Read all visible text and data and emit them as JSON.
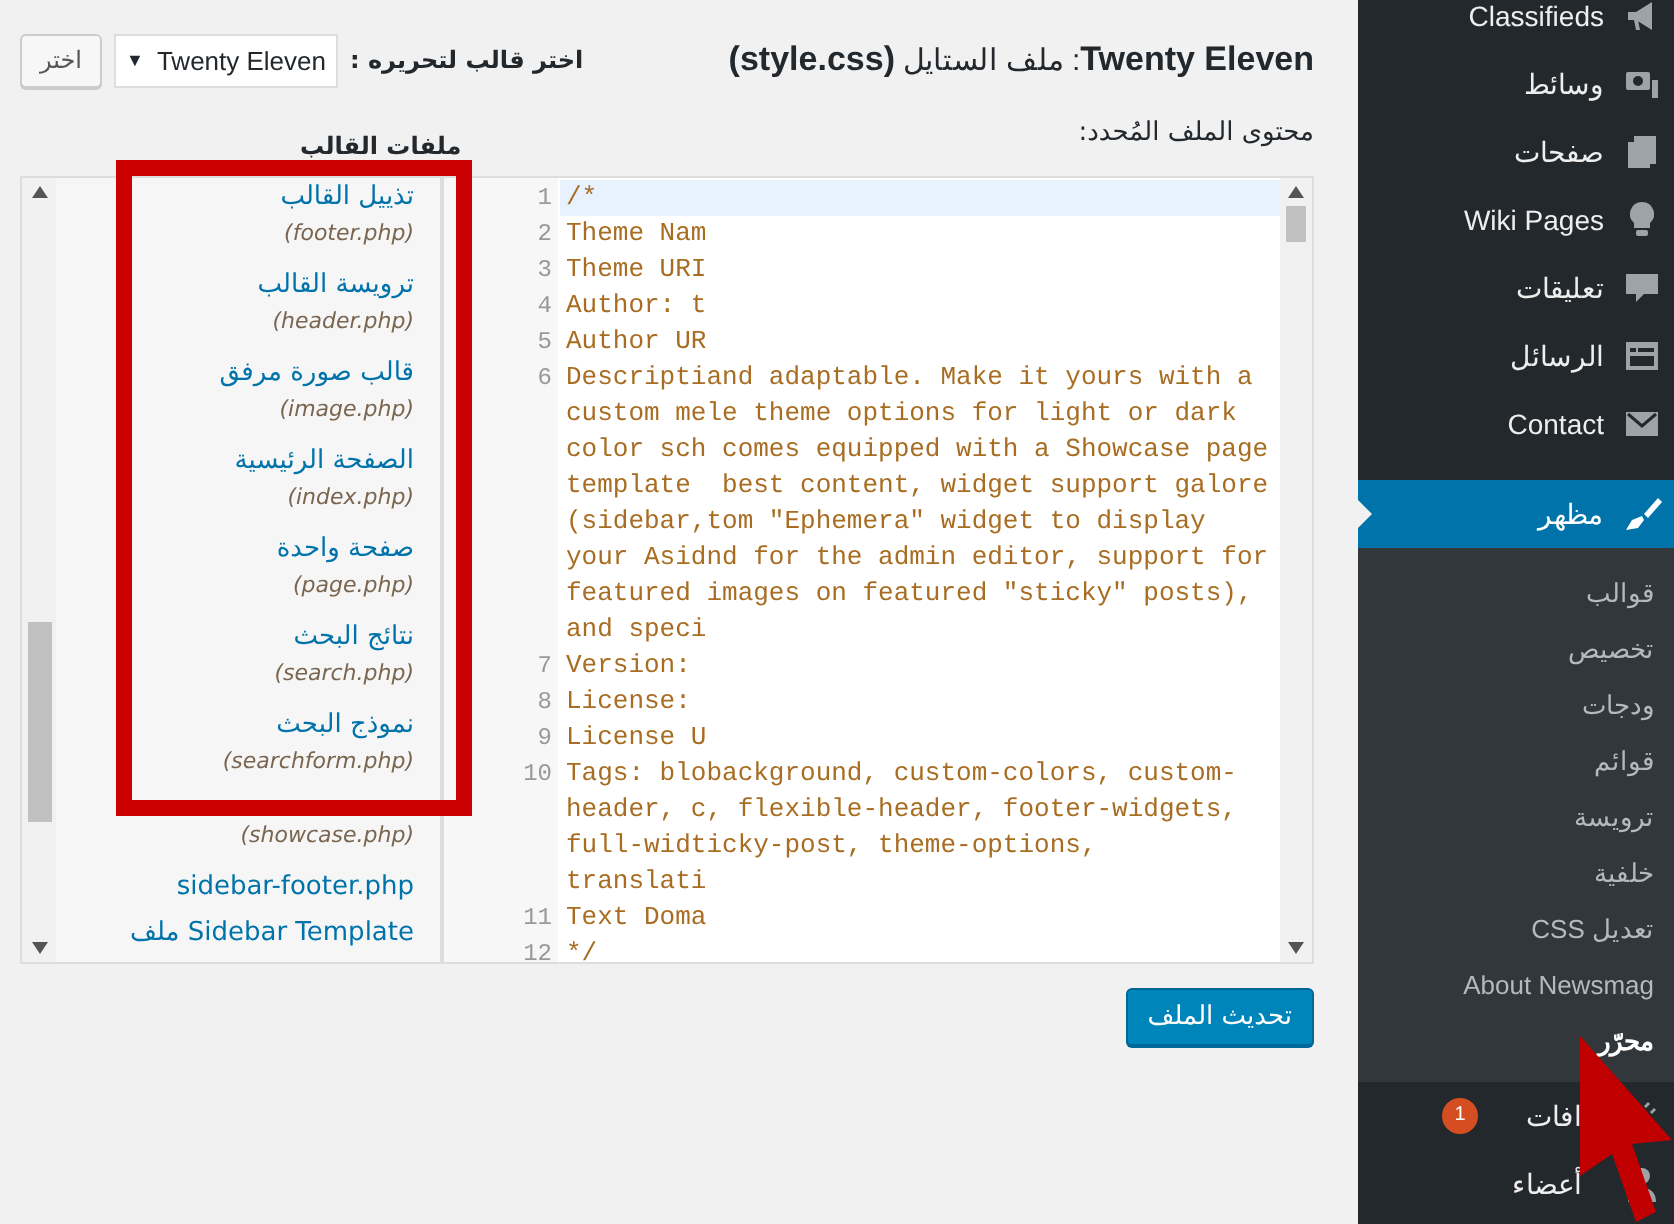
{
  "header": {
    "title": "**Twenty Eleven**: ملف الستايل **(style.css)**",
    "theme_label": "اختر قالب لتحريره :",
    "theme_select": "Twenty Eleven",
    "select_caret": "▼",
    "select_button": "اختر"
  },
  "editor_label": "محتوى الملف المُحدد:",
  "files_heading": "ملفات القالب",
  "files": [
    {
      "title": "تذييل القالب",
      "file": "(footer.php)"
    },
    {
      "title": "ترويسة القالب",
      "file": "(header.php)"
    },
    {
      "title": "قالب صورة مرفق",
      "file": "(image.php)"
    },
    {
      "title": "الصفحة الرئيسية",
      "file": "(index.php)"
    },
    {
      "title": "صفحة واحدة",
      "file": "(page.php)"
    },
    {
      "title": "نتائج البحث",
      "file": "(search.php)"
    },
    {
      "title": "نموذج البحث",
      "file": "(searchform.php)"
    },
    {
      "file": "(showcase.php)"
    },
    {
      "title": "sidebar-footer.php"
    },
    {
      "title": "Sidebar Template ملف"
    }
  ],
  "code_lines": [
    {
      "number": "1",
      "active": true,
      "rows": [
        "/*"
      ]
    },
    {
      "number": "2",
      "active": false,
      "rows": [
        "Theme Nam"
      ]
    },
    {
      "number": "3",
      "active": false,
      "rows": [
        "Theme URI"
      ]
    },
    {
      "number": "4",
      "active": false,
      "rows": [
        "Author: t"
      ]
    },
    {
      "number": "5",
      "active": false,
      "rows": [
        "Author UR"
      ]
    },
    {
      "number": "6",
      "active": false,
      "rows": [
        "Descriptiand adaptable. Make it yours with a",
        "custom mele theme options for light or dark",
        "color sch comes equipped with a Showcase page",
        "template  best content, widget support galore",
        "(sidebar,tom \"Ephemera\" widget to display",
        "your Asidnd for the admin editor, support for",
        "featured images on featured \"sticky\" posts),",
        "and speci"
      ]
    },
    {
      "number": "7",
      "active": false,
      "rows": [
        "Version:"
      ]
    },
    {
      "number": "8",
      "active": false,
      "rows": [
        "License:"
      ]
    },
    {
      "number": "9",
      "active": false,
      "rows": [
        "License U"
      ]
    },
    {
      "number": "10",
      "active": false,
      "rows": [
        "Tags: blobackground, custom-colors, custom-",
        "header, c, flexible-header, footer-widgets,",
        "full-widticky-post, theme-options,",
        "translati"
      ]
    },
    {
      "number": "11",
      "active": false,
      "rows": [
        "Text Doma"
      ]
    },
    {
      "number": "12",
      "active": false,
      "rows": [
        "*/"
      ]
    }
  ],
  "update_button": "تحديث الملف",
  "menu": [
    {
      "label": "Classifieds",
      "selected": false
    },
    {
      "label": "وسائط",
      "selected": false
    },
    {
      "label": "صفحات",
      "selected": false
    },
    {
      "label": "Wiki Pages",
      "selected": false
    },
    {
      "label": "تعليقات",
      "selected": false
    },
    {
      "label": "الرسائل",
      "selected": false
    },
    {
      "label": "Contact",
      "selected": false
    },
    {
      "label": "مظهر",
      "selected": true,
      "children": [
        {
          "label": "قوالب",
          "selected": false
        },
        {
          "label": "تخصيص",
          "selected": false
        },
        {
          "label": "ودجات",
          "selected": false
        },
        {
          "label": "قوائم",
          "selected": false
        },
        {
          "label": "ترويسة",
          "selected": false
        },
        {
          "label": "خلفية",
          "selected": false
        },
        {
          "label": "تعديل CSS",
          "selected": false
        },
        {
          "label": "About Newsmag",
          "selected": false
        },
        {
          "label": "محرّر",
          "selected": true
        }
      ]
    },
    {
      "label": "افات",
      "selected": false,
      "badge": "1"
    },
    {
      "label": "أعضاء",
      "selected": false
    }
  ]
}
